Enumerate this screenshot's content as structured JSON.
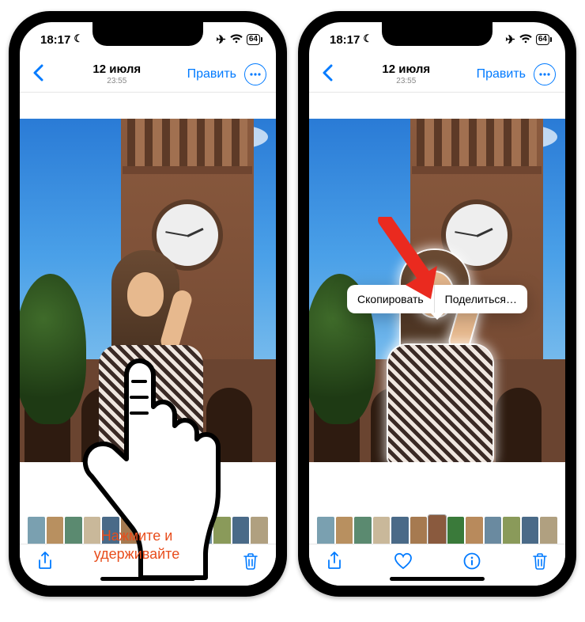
{
  "status": {
    "time": "18:17",
    "battery": "64"
  },
  "nav": {
    "title": "12 июля",
    "subtitle": "23:55",
    "edit": "Править"
  },
  "popover": {
    "copy": "Скопировать",
    "share": "Поделиться…"
  },
  "hint": "Нажмите и\nудерживайте",
  "thumbs": [
    "#7aa0b0",
    "#b89060",
    "#5b8a70",
    "#c9b89a",
    "#4a6a88",
    "#a67a50",
    "#8a5a3e",
    "#3a7a3a",
    "#b88a5c",
    "#6a8aa0",
    "#8a9a5a",
    "#4a6a88",
    "#b0a080"
  ],
  "selected_thumb_index": 6
}
